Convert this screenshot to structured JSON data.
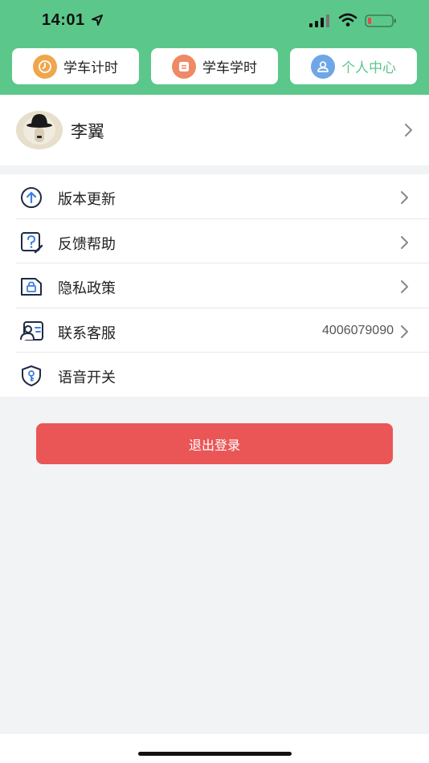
{
  "status_bar": {
    "time": "14:01"
  },
  "tabs": [
    {
      "label": "学车计时",
      "icon": "clock-icon",
      "icon_color": "#f0a64c"
    },
    {
      "label": "学车学时",
      "icon": "list-icon",
      "icon_color": "#ef8a66"
    },
    {
      "label": "个人中心",
      "icon": "person-icon",
      "icon_color": "#6fa7e6",
      "active": true
    }
  ],
  "profile": {
    "name": "李翼"
  },
  "menu": {
    "items": [
      {
        "label": "版本更新",
        "icon": "upload-arrow-icon",
        "has_chevron": true
      },
      {
        "label": "反馈帮助",
        "icon": "help-edit-icon",
        "has_chevron": true
      },
      {
        "label": "隐私政策",
        "icon": "lock-document-icon",
        "has_chevron": true
      },
      {
        "label": "联系客服",
        "icon": "contact-card-icon",
        "value": "4006079090",
        "has_chevron": true
      },
      {
        "label": "语音开关",
        "icon": "shield-key-icon",
        "has_chevron": false
      }
    ]
  },
  "logout_button": {
    "label": "退出登录"
  },
  "colors": {
    "header_green": "#5cc78b",
    "logout_red": "#ea5656",
    "background": "#f2f3f5"
  }
}
